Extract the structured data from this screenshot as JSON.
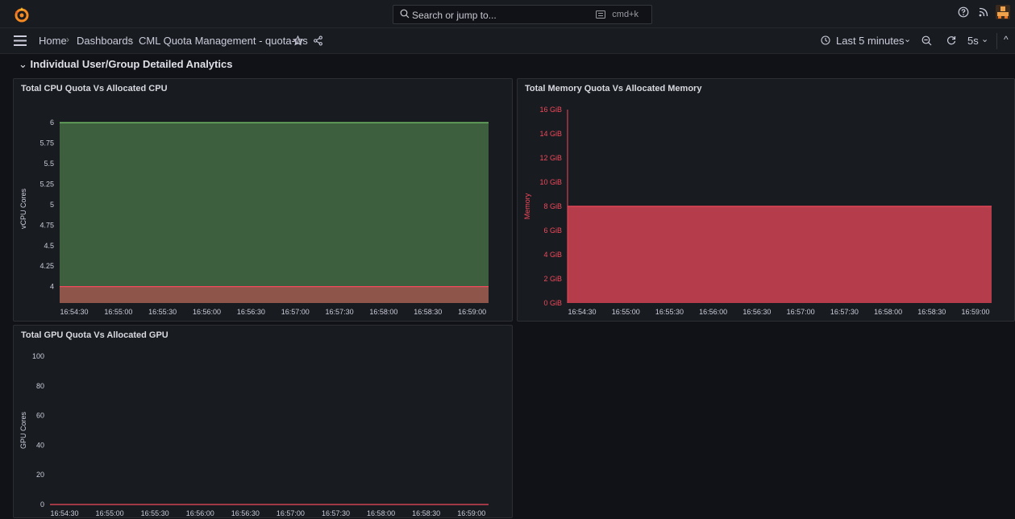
{
  "topbar": {
    "search_placeholder": "Search or jump to...",
    "shortcut": "cmd+k"
  },
  "navbar": {
    "breadcrumb": [
      "Home",
      "Dashboards",
      "CML Quota Management - quota-ws"
    ],
    "time_range": "Last 5 minutes",
    "refresh_interval": "5s"
  },
  "section": {
    "title": "Individual User/Group Detailed Analytics"
  },
  "colors": {
    "green": "#73bf69",
    "red": "#f2495c",
    "orange": "#ff780a"
  },
  "chart_data": [
    {
      "type": "area",
      "title": "Total CPU Quota Vs Allocated CPU",
      "ylabel": "vCPU Cores",
      "ylim": [
        3.8,
        6.1
      ],
      "yticks": [
        "6",
        "5.75",
        "5.5",
        "5.25",
        "5",
        "4.75",
        "4.5",
        "4.25",
        "4"
      ],
      "x": [
        "16:54:30",
        "16:55:00",
        "16:55:30",
        "16:56:00",
        "16:56:30",
        "16:57:00",
        "16:57:30",
        "16:58:00",
        "16:58:30",
        "16:59:00"
      ],
      "series": [
        {
          "values": [
            6,
            6,
            6,
            6,
            6,
            6,
            6,
            6,
            6,
            6
          ]
        },
        {
          "values": [
            4,
            4,
            4,
            4,
            4,
            4,
            4,
            4,
            4,
            4
          ]
        }
      ]
    },
    {
      "type": "area",
      "title": "Total Memory Quota Vs Allocated Memory",
      "ylabel": "Memory",
      "ylim": [
        0,
        16
      ],
      "yticks": [
        "16 GiB",
        "14 GiB",
        "12 GiB",
        "10 GiB",
        "8 GiB",
        "6 GiB",
        "4 GiB",
        "2 GiB",
        "0 GiB"
      ],
      "x": [
        "16:54:30",
        "16:55:00",
        "16:55:30",
        "16:56:00",
        "16:56:30",
        "16:57:00",
        "16:57:30",
        "16:58:00",
        "16:58:30",
        "16:59:00"
      ],
      "series": [
        {
          "values": [
            8,
            8,
            8,
            8,
            8,
            8,
            8,
            8,
            8,
            8
          ]
        }
      ]
    },
    {
      "type": "line",
      "title": "Total GPU Quota Vs Allocated GPU",
      "ylabel": "GPU Cores",
      "ylim": [
        0,
        100
      ],
      "yticks": [
        "100",
        "80",
        "60",
        "40",
        "20",
        "0"
      ],
      "x": [
        "16:54:30",
        "16:55:00",
        "16:55:30",
        "16:56:00",
        "16:56:30",
        "16:57:00",
        "16:57:30",
        "16:58:00",
        "16:58:30",
        "16:59:00"
      ],
      "series": [
        {
          "values": [
            0,
            0,
            0,
            0,
            0,
            0,
            0,
            0,
            0,
            0
          ]
        }
      ]
    }
  ]
}
